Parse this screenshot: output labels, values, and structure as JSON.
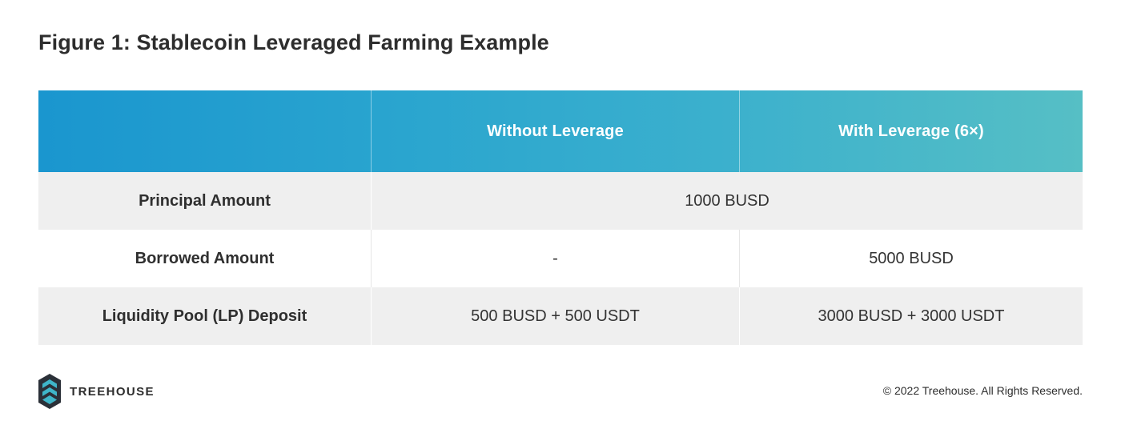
{
  "title": "Figure 1: Stablecoin Leveraged Farming Example",
  "table": {
    "headers": [
      "",
      "Without Leverage",
      "With Leverage (6×)"
    ],
    "rows": [
      {
        "label": "Principal Amount",
        "merged_value": "1000 BUSD"
      },
      {
        "label": "Borrowed Amount",
        "values": [
          "-",
          "5000 BUSD"
        ]
      },
      {
        "label": "Liquidity Pool (LP) Deposit",
        "values": [
          "500 BUSD + 500 USDT",
          "3000 BUSD + 3000 USDT"
        ]
      }
    ]
  },
  "footer": {
    "brand": "TREEHOUSE",
    "logo_icon": "treehouse-logo-icon",
    "copyright": "© 2022 Treehouse. All Rights Reserved."
  },
  "colors": {
    "header_gradient_start": "#1a96cf",
    "header_gradient_end": "#56bfc5",
    "row_grey": "#efefef",
    "logo_dark": "#2b3038",
    "logo_teal": "#3fb6c9"
  }
}
